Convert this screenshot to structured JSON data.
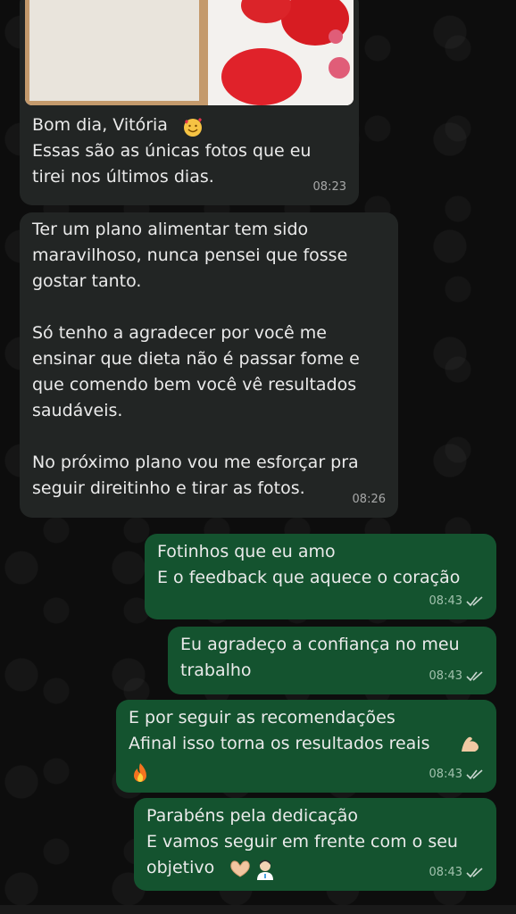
{
  "messages": [
    {
      "id": "m1",
      "dir": "in",
      "text": "Bom dia, Vitória \nEssas são as únicas fotos que eu\ntirei nos últimos dias.",
      "time": "08:23",
      "has_photo": true,
      "emoji": "smiling-face-with-hearts"
    },
    {
      "id": "m2",
      "dir": "in",
      "text": "Ter um plano alimentar tem sido\nmaravilhoso, nunca pensei que fosse\ngostar tanto.\n\nSó tenho a agradecer por você me\nensinar que dieta não é passar fome e\nque comendo bem você vê resultados\nsaudáveis.\n\nNo próximo plano vou me esforçar pra\nseguir direitinho e tirar as fotos.",
      "time": "08:26"
    },
    {
      "id": "m3",
      "dir": "out",
      "text": "Fotinhos que eu amo\nE o feedback que aquece o coração",
      "time": "08:43",
      "read": true
    },
    {
      "id": "m4",
      "dir": "out",
      "text": "Eu agradeço a confiança no meu\ntrabalho",
      "time": "08:43",
      "read": true
    },
    {
      "id": "m5",
      "dir": "out",
      "text": "E por seguir as recomendações\nAfinal isso torna os resultados reais",
      "time": "08:43",
      "read": true,
      "emoji": [
        "flexed-biceps",
        "fire"
      ]
    },
    {
      "id": "m6",
      "dir": "out",
      "text": "Parabéns pela dedicação\nE vamos seguir em frente com o seu\nobjetivo",
      "time": "08:43",
      "read": true,
      "emoji": [
        "heart-hands",
        "woman-health-worker"
      ]
    }
  ],
  "colors": {
    "incoming": "#222524",
    "outgoing": "#14532f",
    "background": "#0d0d0d"
  }
}
